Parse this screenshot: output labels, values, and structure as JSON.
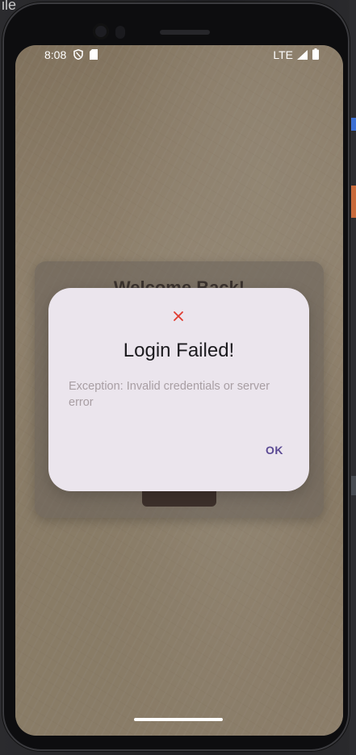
{
  "edge": {
    "left_text": "ile"
  },
  "status_bar": {
    "time": "8:08",
    "network": "LTE",
    "icons": [
      "shield-icon",
      "sd-card-icon",
      "signal-icon",
      "battery-icon"
    ]
  },
  "background_card": {
    "title": "Welcome Back!"
  },
  "dialog": {
    "icon": "close-icon",
    "title": "Login Failed!",
    "message": "Exception: Invalid credentials or server error",
    "ok_label": "OK"
  },
  "colors": {
    "dialog_bg": "#ebe5ed",
    "error_icon": "#e03a2f",
    "action": "#5b4a94",
    "message_text": "#a89ea3"
  }
}
